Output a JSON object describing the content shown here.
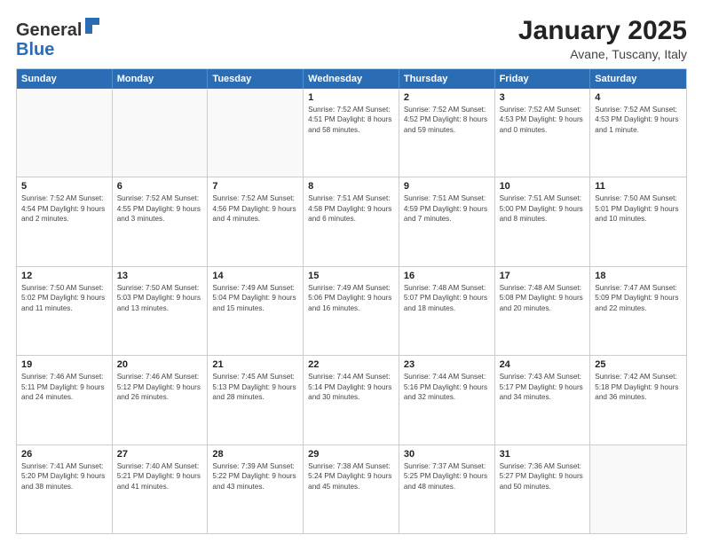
{
  "logo": {
    "general": "General",
    "blue": "Blue"
  },
  "title": "January 2025",
  "location": "Avane, Tuscany, Italy",
  "days_of_week": [
    "Sunday",
    "Monday",
    "Tuesday",
    "Wednesday",
    "Thursday",
    "Friday",
    "Saturday"
  ],
  "weeks": [
    [
      {
        "day": "",
        "detail": ""
      },
      {
        "day": "",
        "detail": ""
      },
      {
        "day": "",
        "detail": ""
      },
      {
        "day": "1",
        "detail": "Sunrise: 7:52 AM\nSunset: 4:51 PM\nDaylight: 8 hours and 58 minutes."
      },
      {
        "day": "2",
        "detail": "Sunrise: 7:52 AM\nSunset: 4:52 PM\nDaylight: 8 hours and 59 minutes."
      },
      {
        "day": "3",
        "detail": "Sunrise: 7:52 AM\nSunset: 4:53 PM\nDaylight: 9 hours and 0 minutes."
      },
      {
        "day": "4",
        "detail": "Sunrise: 7:52 AM\nSunset: 4:53 PM\nDaylight: 9 hours and 1 minute."
      }
    ],
    [
      {
        "day": "5",
        "detail": "Sunrise: 7:52 AM\nSunset: 4:54 PM\nDaylight: 9 hours and 2 minutes."
      },
      {
        "day": "6",
        "detail": "Sunrise: 7:52 AM\nSunset: 4:55 PM\nDaylight: 9 hours and 3 minutes."
      },
      {
        "day": "7",
        "detail": "Sunrise: 7:52 AM\nSunset: 4:56 PM\nDaylight: 9 hours and 4 minutes."
      },
      {
        "day": "8",
        "detail": "Sunrise: 7:51 AM\nSunset: 4:58 PM\nDaylight: 9 hours and 6 minutes."
      },
      {
        "day": "9",
        "detail": "Sunrise: 7:51 AM\nSunset: 4:59 PM\nDaylight: 9 hours and 7 minutes."
      },
      {
        "day": "10",
        "detail": "Sunrise: 7:51 AM\nSunset: 5:00 PM\nDaylight: 9 hours and 8 minutes."
      },
      {
        "day": "11",
        "detail": "Sunrise: 7:50 AM\nSunset: 5:01 PM\nDaylight: 9 hours and 10 minutes."
      }
    ],
    [
      {
        "day": "12",
        "detail": "Sunrise: 7:50 AM\nSunset: 5:02 PM\nDaylight: 9 hours and 11 minutes."
      },
      {
        "day": "13",
        "detail": "Sunrise: 7:50 AM\nSunset: 5:03 PM\nDaylight: 9 hours and 13 minutes."
      },
      {
        "day": "14",
        "detail": "Sunrise: 7:49 AM\nSunset: 5:04 PM\nDaylight: 9 hours and 15 minutes."
      },
      {
        "day": "15",
        "detail": "Sunrise: 7:49 AM\nSunset: 5:06 PM\nDaylight: 9 hours and 16 minutes."
      },
      {
        "day": "16",
        "detail": "Sunrise: 7:48 AM\nSunset: 5:07 PM\nDaylight: 9 hours and 18 minutes."
      },
      {
        "day": "17",
        "detail": "Sunrise: 7:48 AM\nSunset: 5:08 PM\nDaylight: 9 hours and 20 minutes."
      },
      {
        "day": "18",
        "detail": "Sunrise: 7:47 AM\nSunset: 5:09 PM\nDaylight: 9 hours and 22 minutes."
      }
    ],
    [
      {
        "day": "19",
        "detail": "Sunrise: 7:46 AM\nSunset: 5:11 PM\nDaylight: 9 hours and 24 minutes."
      },
      {
        "day": "20",
        "detail": "Sunrise: 7:46 AM\nSunset: 5:12 PM\nDaylight: 9 hours and 26 minutes."
      },
      {
        "day": "21",
        "detail": "Sunrise: 7:45 AM\nSunset: 5:13 PM\nDaylight: 9 hours and 28 minutes."
      },
      {
        "day": "22",
        "detail": "Sunrise: 7:44 AM\nSunset: 5:14 PM\nDaylight: 9 hours and 30 minutes."
      },
      {
        "day": "23",
        "detail": "Sunrise: 7:44 AM\nSunset: 5:16 PM\nDaylight: 9 hours and 32 minutes."
      },
      {
        "day": "24",
        "detail": "Sunrise: 7:43 AM\nSunset: 5:17 PM\nDaylight: 9 hours and 34 minutes."
      },
      {
        "day": "25",
        "detail": "Sunrise: 7:42 AM\nSunset: 5:18 PM\nDaylight: 9 hours and 36 minutes."
      }
    ],
    [
      {
        "day": "26",
        "detail": "Sunrise: 7:41 AM\nSunset: 5:20 PM\nDaylight: 9 hours and 38 minutes."
      },
      {
        "day": "27",
        "detail": "Sunrise: 7:40 AM\nSunset: 5:21 PM\nDaylight: 9 hours and 41 minutes."
      },
      {
        "day": "28",
        "detail": "Sunrise: 7:39 AM\nSunset: 5:22 PM\nDaylight: 9 hours and 43 minutes."
      },
      {
        "day": "29",
        "detail": "Sunrise: 7:38 AM\nSunset: 5:24 PM\nDaylight: 9 hours and 45 minutes."
      },
      {
        "day": "30",
        "detail": "Sunrise: 7:37 AM\nSunset: 5:25 PM\nDaylight: 9 hours and 48 minutes."
      },
      {
        "day": "31",
        "detail": "Sunrise: 7:36 AM\nSunset: 5:27 PM\nDaylight: 9 hours and 50 minutes."
      },
      {
        "day": "",
        "detail": ""
      }
    ]
  ]
}
